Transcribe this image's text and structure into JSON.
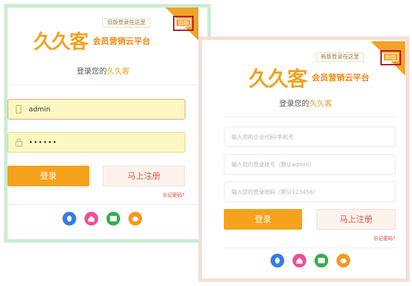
{
  "left_panel": {
    "hint": "旧版登录在这里",
    "version_label": "旧版",
    "logo_mark": "久久客",
    "logo_text": "会员营销云平台",
    "subtitle_prefix": "登录您的",
    "subtitle_brand": "久久客",
    "username_value": "admin",
    "password_value": "••••••",
    "login_label": "登录",
    "register_label": "马上注册",
    "forgot_label": "忘记密码?"
  },
  "right_panel": {
    "hint": "新版登录在这里",
    "version_label": "新版",
    "logo_mark": "久久客",
    "logo_text": "会员营销云平台",
    "subtitle_prefix": "登录您的",
    "subtitle_brand": "久久客",
    "company_placeholder": "输入您的企业代码/手机号",
    "account_placeholder": "输入您的登录账号（默认admin）",
    "password_placeholder": "输入您的登录密码（默认123456）",
    "login_label": "登录",
    "register_label": "马上注册",
    "forgot_label": "忘记密码?"
  },
  "socials": [
    {
      "icon": "qq-icon",
      "color": "#2f7ee6"
    },
    {
      "icon": "home-icon",
      "color": "#ef4f95"
    },
    {
      "icon": "wechat-icon",
      "color": "#2fb24a"
    },
    {
      "icon": "weibo-icon",
      "color": "#f39a1c"
    }
  ],
  "colors": {
    "accent": "#f6a21c",
    "corner": "#f2a227",
    "highlight": "#b5161c"
  }
}
